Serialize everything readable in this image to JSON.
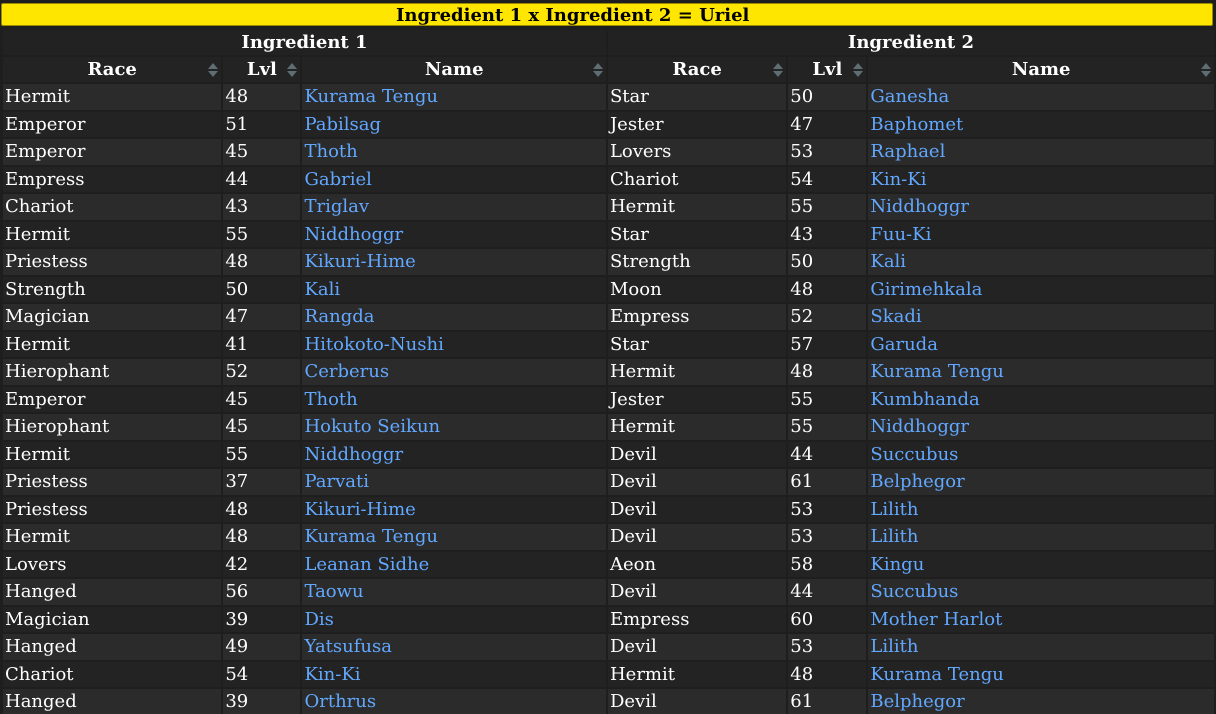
{
  "title": "Ingredient 1 x Ingredient 2 = Uriel",
  "groups": [
    "Ingredient 1",
    "Ingredient 2"
  ],
  "columns": [
    "Race",
    "Lvl",
    "Name",
    "Race",
    "Lvl",
    "Name"
  ],
  "rows": [
    [
      "Hermit",
      "48",
      "Kurama Tengu",
      "Star",
      "50",
      "Ganesha"
    ],
    [
      "Emperor",
      "51",
      "Pabilsag",
      "Jester",
      "47",
      "Baphomet"
    ],
    [
      "Emperor",
      "45",
      "Thoth",
      "Lovers",
      "53",
      "Raphael"
    ],
    [
      "Empress",
      "44",
      "Gabriel",
      "Chariot",
      "54",
      "Kin-Ki"
    ],
    [
      "Chariot",
      "43",
      "Triglav",
      "Hermit",
      "55",
      "Niddhoggr"
    ],
    [
      "Hermit",
      "55",
      "Niddhoggr",
      "Star",
      "43",
      "Fuu-Ki"
    ],
    [
      "Priestess",
      "48",
      "Kikuri-Hime",
      "Strength",
      "50",
      "Kali"
    ],
    [
      "Strength",
      "50",
      "Kali",
      "Moon",
      "48",
      "Girimehkala"
    ],
    [
      "Magician",
      "47",
      "Rangda",
      "Empress",
      "52",
      "Skadi"
    ],
    [
      "Hermit",
      "41",
      "Hitokoto-Nushi",
      "Star",
      "57",
      "Garuda"
    ],
    [
      "Hierophant",
      "52",
      "Cerberus",
      "Hermit",
      "48",
      "Kurama Tengu"
    ],
    [
      "Emperor",
      "45",
      "Thoth",
      "Jester",
      "55",
      "Kumbhanda"
    ],
    [
      "Hierophant",
      "45",
      "Hokuto Seikun",
      "Hermit",
      "55",
      "Niddhoggr"
    ],
    [
      "Hermit",
      "55",
      "Niddhoggr",
      "Devil",
      "44",
      "Succubus"
    ],
    [
      "Priestess",
      "37",
      "Parvati",
      "Devil",
      "61",
      "Belphegor"
    ],
    [
      "Priestess",
      "48",
      "Kikuri-Hime",
      "Devil",
      "53",
      "Lilith"
    ],
    [
      "Hermit",
      "48",
      "Kurama Tengu",
      "Devil",
      "53",
      "Lilith"
    ],
    [
      "Lovers",
      "42",
      "Leanan Sidhe",
      "Aeon",
      "58",
      "Kingu"
    ],
    [
      "Hanged",
      "56",
      "Taowu",
      "Devil",
      "44",
      "Succubus"
    ],
    [
      "Magician",
      "39",
      "Dis",
      "Empress",
      "60",
      "Mother Harlot"
    ],
    [
      "Hanged",
      "49",
      "Yatsufusa",
      "Devil",
      "53",
      "Lilith"
    ],
    [
      "Chariot",
      "54",
      "Kin-Ki",
      "Hermit",
      "48",
      "Kurama Tengu"
    ],
    [
      "Hanged",
      "39",
      "Orthrus",
      "Devil",
      "61",
      "Belphegor"
    ]
  ]
}
